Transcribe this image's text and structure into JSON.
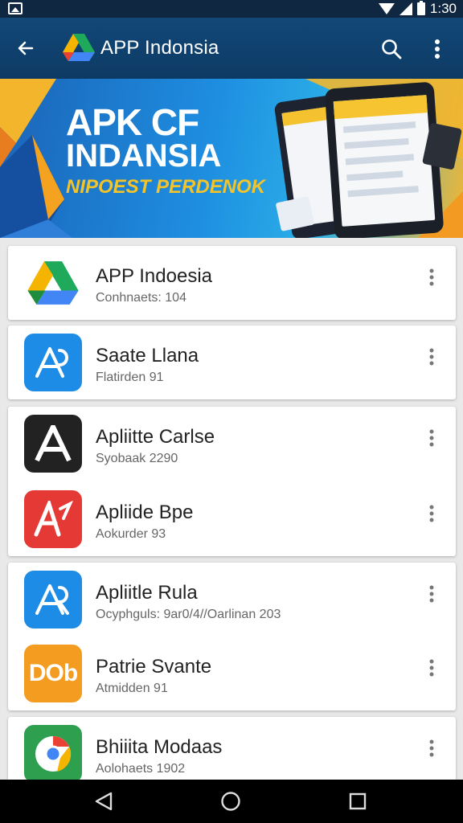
{
  "status_bar": {
    "time": "1:30"
  },
  "app_bar": {
    "title": "APP Indonsia"
  },
  "banner": {
    "line1": "APK CF",
    "line2": "INDANSIA",
    "line3": "NIPOEST PERDENOK"
  },
  "apps": [
    {
      "title": "APP Indoesia",
      "subtitle": "Conhnaets: 104",
      "icon": "drive-triangle-icon",
      "icon_bg": "#ffffff"
    },
    {
      "title": "Saate Llana",
      "subtitle": "Flatirden 91",
      "icon": "app-store-icon",
      "icon_bg": "#1c8ce6"
    },
    {
      "title": "Apliitte Carlse",
      "subtitle": "Syobaak 2290",
      "icon": "letter-a-icon",
      "icon_bg": "#222222"
    },
    {
      "title": "Apliide Bpe",
      "subtitle": "Aokurder 93",
      "icon": "app-a-red-icon",
      "icon_bg": "#e53935"
    },
    {
      "title": "Apliitle Rula",
      "subtitle": "Ocyphguls: 9ar0/4//Oarlinan 203",
      "icon": "app-store-icon",
      "icon_bg": "#1c8ce6"
    },
    {
      "title": "Patrie Svante",
      "subtitle": "Atmidden 91",
      "icon": "dob-icon",
      "icon_bg": "#f39c1f"
    },
    {
      "title": "Bhiiita Modaas",
      "subtitle": "Aolohaets 1902",
      "icon": "chrome-like-icon",
      "icon_bg": "#2e9e4f"
    }
  ],
  "icon_text": {
    "dob": "DOb"
  },
  "colors": {
    "app_bar": "#124878",
    "accent_yellow": "#f3c32a",
    "nav_bar": "#000000"
  }
}
